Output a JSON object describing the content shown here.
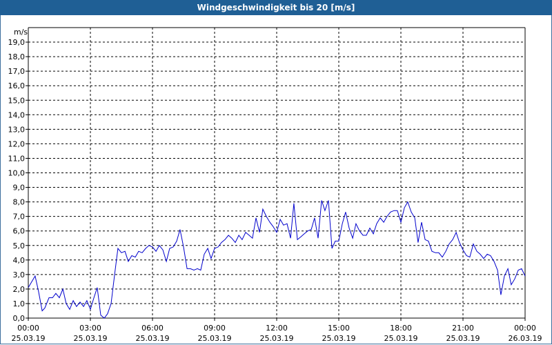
{
  "window": {
    "title": "Windgeschwindigkeit bis 20 [m/s]"
  },
  "chart_data": {
    "type": "line",
    "title": "Windgeschwindigkeit bis 20 [m/s]",
    "ylabel": "m/s",
    "xlabel": "",
    "ylim": [
      0,
      20
    ],
    "xlim_hours": [
      0,
      24
    ],
    "grid": true,
    "grid_style": "dashed",
    "line_color": "#0000cc",
    "y_ticks": [
      "0,0",
      "1,0",
      "2,0",
      "3,0",
      "4,0",
      "5,0",
      "6,0",
      "7,0",
      "8,0",
      "9,0",
      "10,0",
      "11,0",
      "12,0",
      "13,0",
      "14,0",
      "15,0",
      "16,0",
      "17,0",
      "18,0",
      "19,0"
    ],
    "x_ticks": [
      {
        "time": "00:00",
        "date": "25.03.19"
      },
      {
        "time": "03:00",
        "date": "25.03.19"
      },
      {
        "time": "06:00",
        "date": "25.03.19"
      },
      {
        "time": "09:00",
        "date": "25.03.19"
      },
      {
        "time": "12:00",
        "date": "25.03.19"
      },
      {
        "time": "15:00",
        "date": "25.03.19"
      },
      {
        "time": "18:00",
        "date": "25.03.19"
      },
      {
        "time": "21:00",
        "date": "25.03.19"
      },
      {
        "time": "00:00",
        "date": "26.03.19"
      }
    ],
    "series": [
      {
        "x_hours": [
          0,
          0.33,
          0.5,
          0.67,
          0.8,
          1.0,
          1.17,
          1.33,
          1.5,
          1.67,
          1.83,
          2.0,
          2.17,
          2.33,
          2.5,
          2.67,
          2.83,
          3.0,
          3.17,
          3.33,
          3.5,
          3.67,
          3.83,
          4.0,
          4.17,
          4.33,
          4.5,
          4.67,
          4.83,
          5.0,
          5.17,
          5.33,
          5.5,
          5.67,
          5.83,
          6.0,
          6.17,
          6.33,
          6.5,
          6.67,
          6.83,
          7.0,
          7.17,
          7.33,
          7.5,
          7.67,
          7.83,
          8.0,
          8.17,
          8.33,
          8.5,
          8.67,
          8.83,
          9.0,
          9.17,
          9.33,
          9.5,
          9.67,
          9.83,
          10.0,
          10.17,
          10.33,
          10.5,
          10.67,
          10.83,
          11.0,
          11.17,
          11.33,
          11.5,
          11.67,
          11.83,
          12.0,
          12.17,
          12.33,
          12.5,
          12.67,
          12.83,
          13.0,
          13.17,
          13.33,
          13.5,
          13.67,
          13.83,
          14.0,
          14.17,
          14.33,
          14.5,
          14.67,
          14.83,
          15.0,
          15.17,
          15.33,
          15.5,
          15.67,
          15.83,
          16.0,
          16.17,
          16.33,
          16.5,
          16.67,
          16.83,
          17.0,
          17.17,
          17.33,
          17.5,
          17.67,
          17.83,
          18.0,
          18.17,
          18.33,
          18.5,
          18.67,
          18.83,
          19.0,
          19.17,
          19.33,
          19.5,
          19.67,
          19.83,
          20.0,
          20.17,
          20.33,
          20.5,
          20.67,
          20.83,
          21.0,
          21.17,
          21.33,
          21.5,
          21.67,
          21.83,
          22.0,
          22.17,
          22.33,
          22.5,
          22.67,
          22.83,
          23.0,
          23.17,
          23.33,
          23.5,
          23.67,
          23.83,
          24.0
        ],
        "values": [
          2.1,
          2.9,
          1.8,
          0.5,
          0.7,
          1.4,
          1.4,
          1.7,
          1.4,
          2.0,
          1.0,
          0.6,
          1.2,
          0.8,
          1.1,
          0.8,
          1.2,
          0.6,
          1.4,
          2.1,
          0.2,
          0.0,
          0.3,
          1.0,
          3.0,
          4.8,
          4.5,
          4.6,
          3.9,
          4.3,
          4.2,
          4.6,
          4.5,
          4.8,
          5.0,
          4.9,
          4.6,
          5.0,
          4.7,
          3.9,
          4.8,
          4.9,
          5.3,
          6.1,
          4.9,
          3.4,
          3.4,
          3.3,
          3.4,
          3.3,
          4.4,
          4.8,
          4.1,
          4.8,
          4.9,
          5.2,
          5.4,
          5.7,
          5.5,
          5.2,
          5.7,
          5.4,
          5.9,
          5.7,
          5.5,
          6.9,
          5.9,
          7.5,
          7.0,
          6.6,
          6.3,
          5.9,
          6.8,
          6.4,
          6.5,
          5.5,
          7.9,
          5.4,
          5.6,
          5.8,
          6.0,
          6.1,
          6.9,
          5.5,
          8.1,
          7.4,
          8.1,
          4.8,
          5.3,
          5.3,
          6.5,
          7.3,
          6.2,
          5.5,
          6.5,
          6.0,
          5.7,
          5.7,
          6.2,
          5.8,
          6.5,
          6.9,
          6.6,
          7.0,
          7.3,
          7.4,
          7.4,
          6.6,
          7.6,
          8.0,
          7.3,
          6.9,
          5.2,
          6.6,
          5.4,
          5.3,
          4.6,
          4.5,
          4.5,
          4.2,
          4.6,
          5.1,
          5.4,
          5.9,
          5.2,
          4.7,
          4.3,
          4.2,
          5.1,
          4.6,
          4.4,
          4.1,
          4.4,
          4.3,
          3.9,
          3.3,
          1.6,
          2.9,
          3.4,
          2.3,
          2.7,
          3.3,
          3.4,
          2.9,
          3.0,
          3.0
        ]
      }
    ]
  }
}
